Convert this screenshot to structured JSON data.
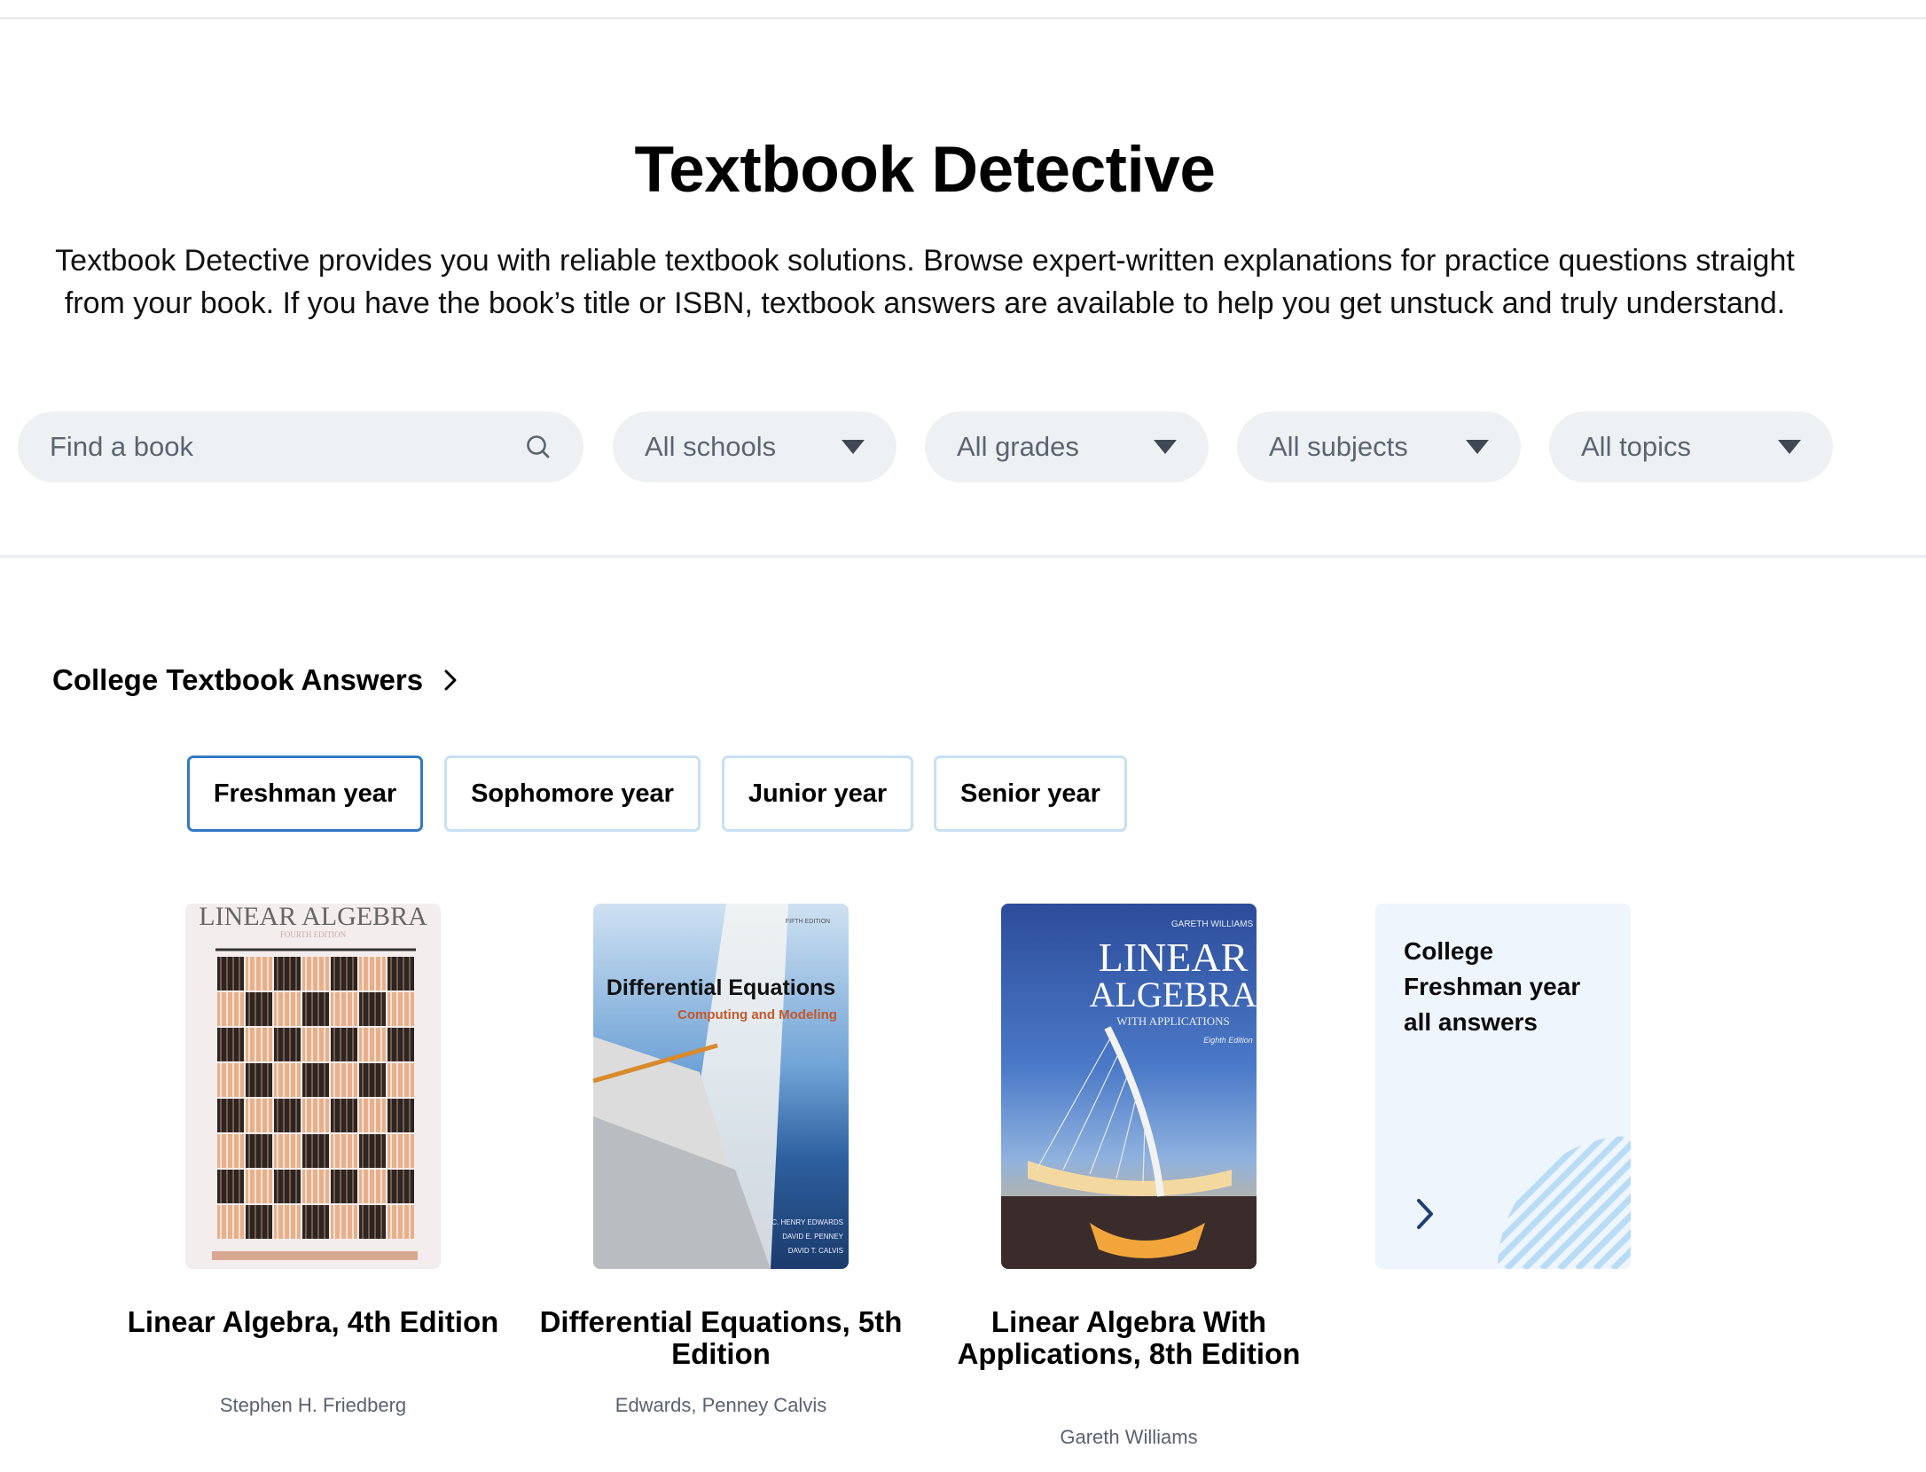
{
  "header": {
    "title": "Textbook Detective",
    "description": "Textbook Detective provides you with reliable textbook solutions. Browse expert-written explanations for practice questions straight from your book. If you have the book’s title or ISBN, textbook answers are available to help you get unstuck and truly understand."
  },
  "filters": {
    "search_placeholder": "Find a book",
    "schools": "All schools",
    "grades": "All grades",
    "subjects": "All subjects",
    "topics": "All topics"
  },
  "section": {
    "title": "College Textbook Answers",
    "tabs": [
      {
        "label": "Freshman year",
        "active": true
      },
      {
        "label": "Sophomore year",
        "active": false
      },
      {
        "label": "Junior year",
        "active": false
      },
      {
        "label": "Senior year",
        "active": false
      }
    ]
  },
  "books": [
    {
      "title": "Linear Algebra, 4th Edition",
      "author": "Stephen H. Friedberg",
      "cover_text": "LINEAR ALGEBRA",
      "cover_subtitle": "FOURTH EDITION"
    },
    {
      "title": "Differential Equations, 5th Edition",
      "author": "Edwards, Penney Calvis",
      "cover_edition": "FIFTH EDITION",
      "cover_title": "Differential Equations",
      "cover_subtitle": "Computing and Modeling",
      "cover_authors": [
        "C. HENRY EDWARDS",
        "DAVID E. PENNEY",
        "DAVID T. CALVIS"
      ]
    },
    {
      "title": "Linear Algebra With Applications, 8th Edition",
      "author": "Gareth Williams",
      "cover_author": "GARETH WILLIAMS",
      "cover_title_1": "LINEAR",
      "cover_title_2": "ALGEBRA",
      "cover_subtitle": "WITH APPLICATIONS",
      "cover_edition": "Eighth Edition"
    }
  ],
  "all_answers_card": {
    "line1": "College",
    "line2": "Freshman year",
    "line3": "all answers"
  },
  "colors": {
    "active_tab_border": "#3279c4",
    "tab_border": "#c7e0f3",
    "pill_bg": "#edf1f4",
    "card_bg": "#eef5fd",
    "card_stripes": "#b9dcf6"
  }
}
